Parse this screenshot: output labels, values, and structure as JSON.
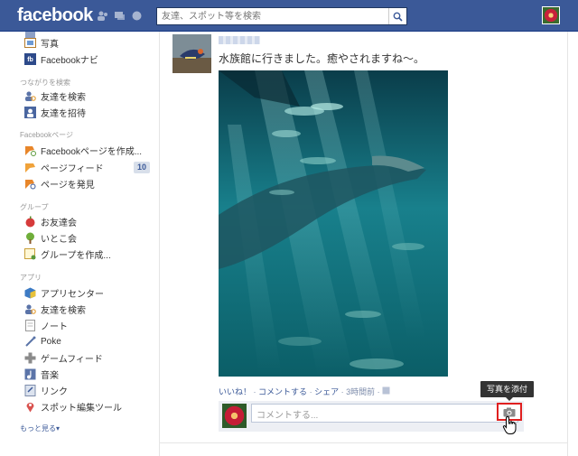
{
  "topbar": {
    "logo": "facebook",
    "search_placeholder": "友達、スポット等を検索"
  },
  "sidebar": {
    "items_top": [
      {
        "label": "写真",
        "icon": "photos-icon"
      },
      {
        "label": "Facebookナビ",
        "icon": "fb-navi-icon"
      }
    ],
    "section_connect": "つながりを検索",
    "items_connect": [
      {
        "label": "友達を検索",
        "icon": "find-friends-icon"
      },
      {
        "label": "友達を招待",
        "icon": "invite-friends-icon"
      }
    ],
    "section_pages": "Facebookページ",
    "items_pages": [
      {
        "label": "Facebookページを作成...",
        "icon": "create-page-icon"
      },
      {
        "label": "ページフィード",
        "icon": "pages-feed-icon",
        "badge": "10"
      },
      {
        "label": "ページを発見",
        "icon": "discover-pages-icon"
      }
    ],
    "section_groups": "グループ",
    "items_groups": [
      {
        "label": "お友達会",
        "icon": "apple-group-icon"
      },
      {
        "label": "いとこ会",
        "icon": "tree-group-icon"
      },
      {
        "label": "グループを作成...",
        "icon": "create-group-icon"
      }
    ],
    "section_apps": "アプリ",
    "items_apps": [
      {
        "label": "アプリセンター",
        "icon": "app-center-icon"
      },
      {
        "label": "友達を検索",
        "icon": "find-friends-icon"
      },
      {
        "label": "ノート",
        "icon": "notes-icon"
      },
      {
        "label": "Poke",
        "icon": "poke-icon"
      },
      {
        "label": "ゲームフィード",
        "icon": "games-feed-icon"
      },
      {
        "label": "音楽",
        "icon": "music-icon"
      },
      {
        "label": "リンク",
        "icon": "links-icon"
      },
      {
        "label": "スポット編集ツール",
        "icon": "place-editor-icon"
      }
    ],
    "more_label": "もっと見る▾"
  },
  "post": {
    "text": "水族館に行きました。癒やされますね～。",
    "actions": {
      "like": "いいね！",
      "comment": "コメントする",
      "share": "シェア",
      "time": "3時間前",
      "sep": "·"
    },
    "comment_placeholder": "コメントする...",
    "camera_tooltip": "写真を添付"
  },
  "colors": {
    "brand": "#3b5998",
    "highlight": "#e02020"
  }
}
